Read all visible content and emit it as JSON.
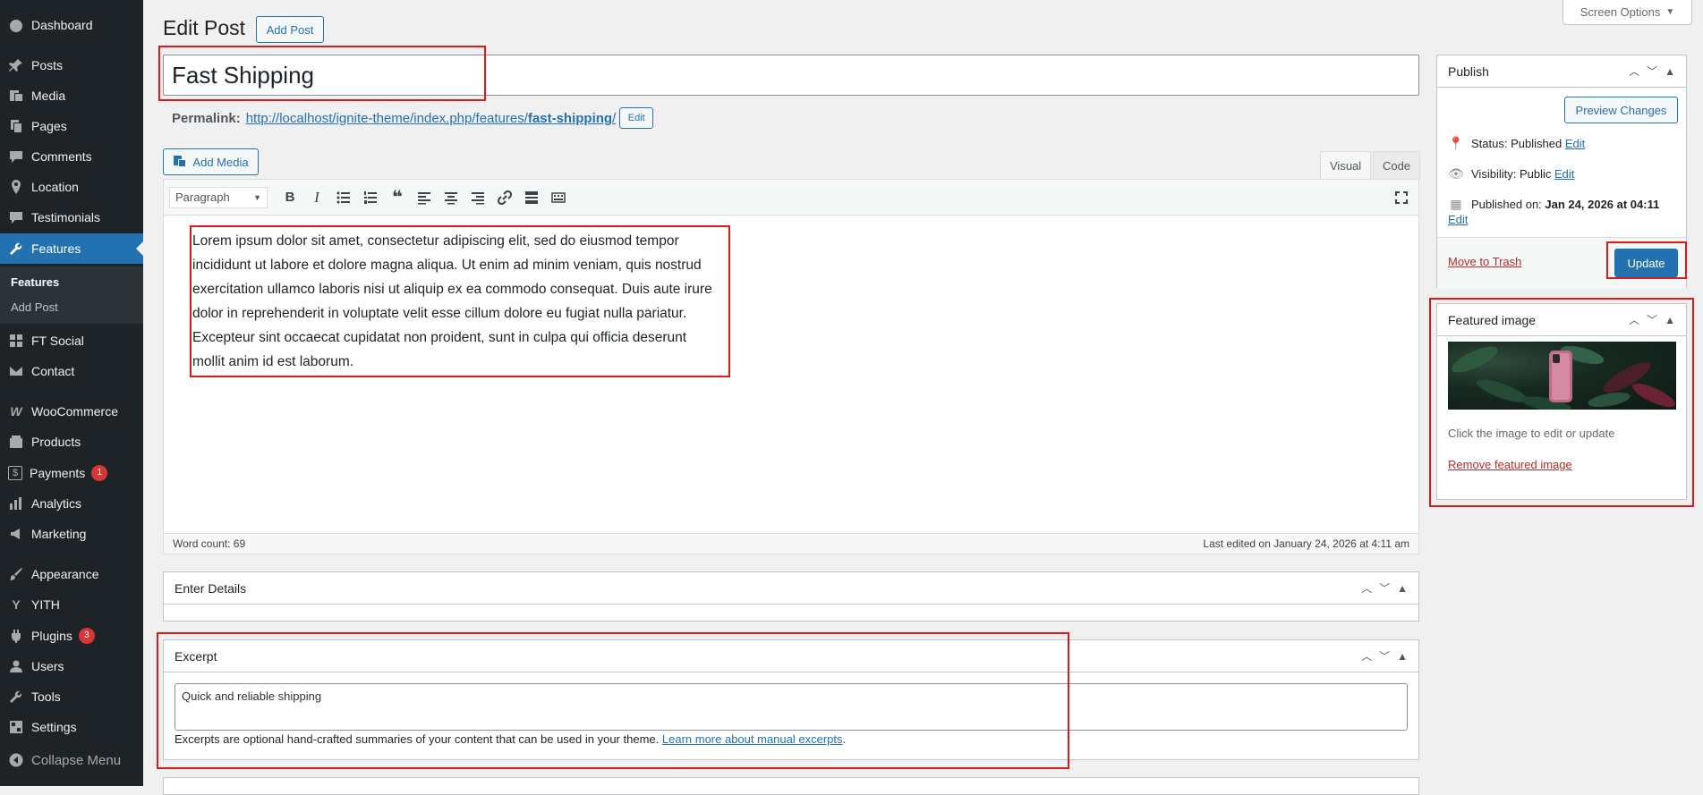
{
  "sidebar": {
    "items": [
      {
        "label": "Dashboard",
        "icon": "dashboard-icon"
      },
      {
        "label": "Posts",
        "icon": "pin-icon"
      },
      {
        "label": "Media",
        "icon": "media-icon"
      },
      {
        "label": "Pages",
        "icon": "pages-icon"
      },
      {
        "label": "Comments",
        "icon": "comment-icon"
      },
      {
        "label": "Location",
        "icon": "location-icon"
      },
      {
        "label": "Testimonials",
        "icon": "testimonial-icon"
      },
      {
        "label": "Features",
        "icon": "wrench-icon"
      },
      {
        "label": "FT Social",
        "icon": "social-icon"
      },
      {
        "label": "Contact",
        "icon": "mail-icon"
      },
      {
        "label": "WooCommerce",
        "icon": "woocommerce-icon"
      },
      {
        "label": "Products",
        "icon": "products-icon"
      },
      {
        "label": "Payments",
        "icon": "payments-icon",
        "badge": "1"
      },
      {
        "label": "Analytics",
        "icon": "analytics-icon"
      },
      {
        "label": "Marketing",
        "icon": "marketing-icon"
      },
      {
        "label": "Appearance",
        "icon": "brush-icon"
      },
      {
        "label": "YITH",
        "icon": "yith-icon"
      },
      {
        "label": "Plugins",
        "icon": "plugin-icon",
        "badge": "3"
      },
      {
        "label": "Users",
        "icon": "users-icon"
      },
      {
        "label": "Tools",
        "icon": "tools-icon"
      },
      {
        "label": "Settings",
        "icon": "settings-icon"
      },
      {
        "label": "Collapse Menu",
        "icon": "collapse-icon"
      }
    ],
    "submenu": [
      "Features",
      "Add Post"
    ]
  },
  "header": {
    "screen_options": "Screen Options",
    "title": "Edit Post",
    "add_post": "Add Post"
  },
  "post": {
    "title": "Fast Shipping",
    "permalink_label": "Permalink:",
    "permalink_url_prefix": "http://localhost/ignite-theme/index.php/features/",
    "permalink_slug": "fast-shipping",
    "permalink_suffix": "/",
    "permalink_edit": "Edit"
  },
  "editor": {
    "add_media": "Add Media",
    "tab_visual": "Visual",
    "tab_code": "Code",
    "format": "Paragraph",
    "content": "Lorem ipsum dolor sit amet, consectetur adipiscing elit, sed do eiusmod tempor incididunt ut labore et dolore magna aliqua. Ut enim ad minim veniam, quis nostrud exercitation ullamco laboris nisi ut aliquip ex ea commodo consequat. Duis aute irure dolor in reprehenderit in voluptate velit esse cillum dolore eu fugiat nulla pariatur. Excepteur sint occaecat cupidatat non proident, sunt in culpa qui officia deserunt mollit anim id est laborum.",
    "word_count": "Word count: 69",
    "last_edited": "Last edited on January 24, 2026 at 4:11 am"
  },
  "details_box": {
    "title": "Enter Details"
  },
  "excerpt_box": {
    "title": "Excerpt",
    "value": "Quick and reliable shipping",
    "help_text": "Excerpts are optional hand-crafted summaries of your content that can be used in your theme.",
    "help_link": "Learn more about manual excerpts",
    "help_end": "."
  },
  "publish_box": {
    "title": "Publish",
    "preview": "Preview Changes",
    "status_label": "Status:",
    "status_value": "Published",
    "visibility_label": "Visibility:",
    "visibility_value": "Public",
    "published_label": "Published on:",
    "published_value": "Jan 24, 2026 at 04:11",
    "edit": "Edit",
    "trash": "Move to Trash",
    "update": "Update"
  },
  "featured_box": {
    "title": "Featured image",
    "hint": "Click the image to edit or update",
    "remove": "Remove featured image"
  },
  "colors": {
    "accent": "#2271b1",
    "sidebar": "#1d2327",
    "highlight": "#e01818",
    "danger": "#b32d2e"
  }
}
